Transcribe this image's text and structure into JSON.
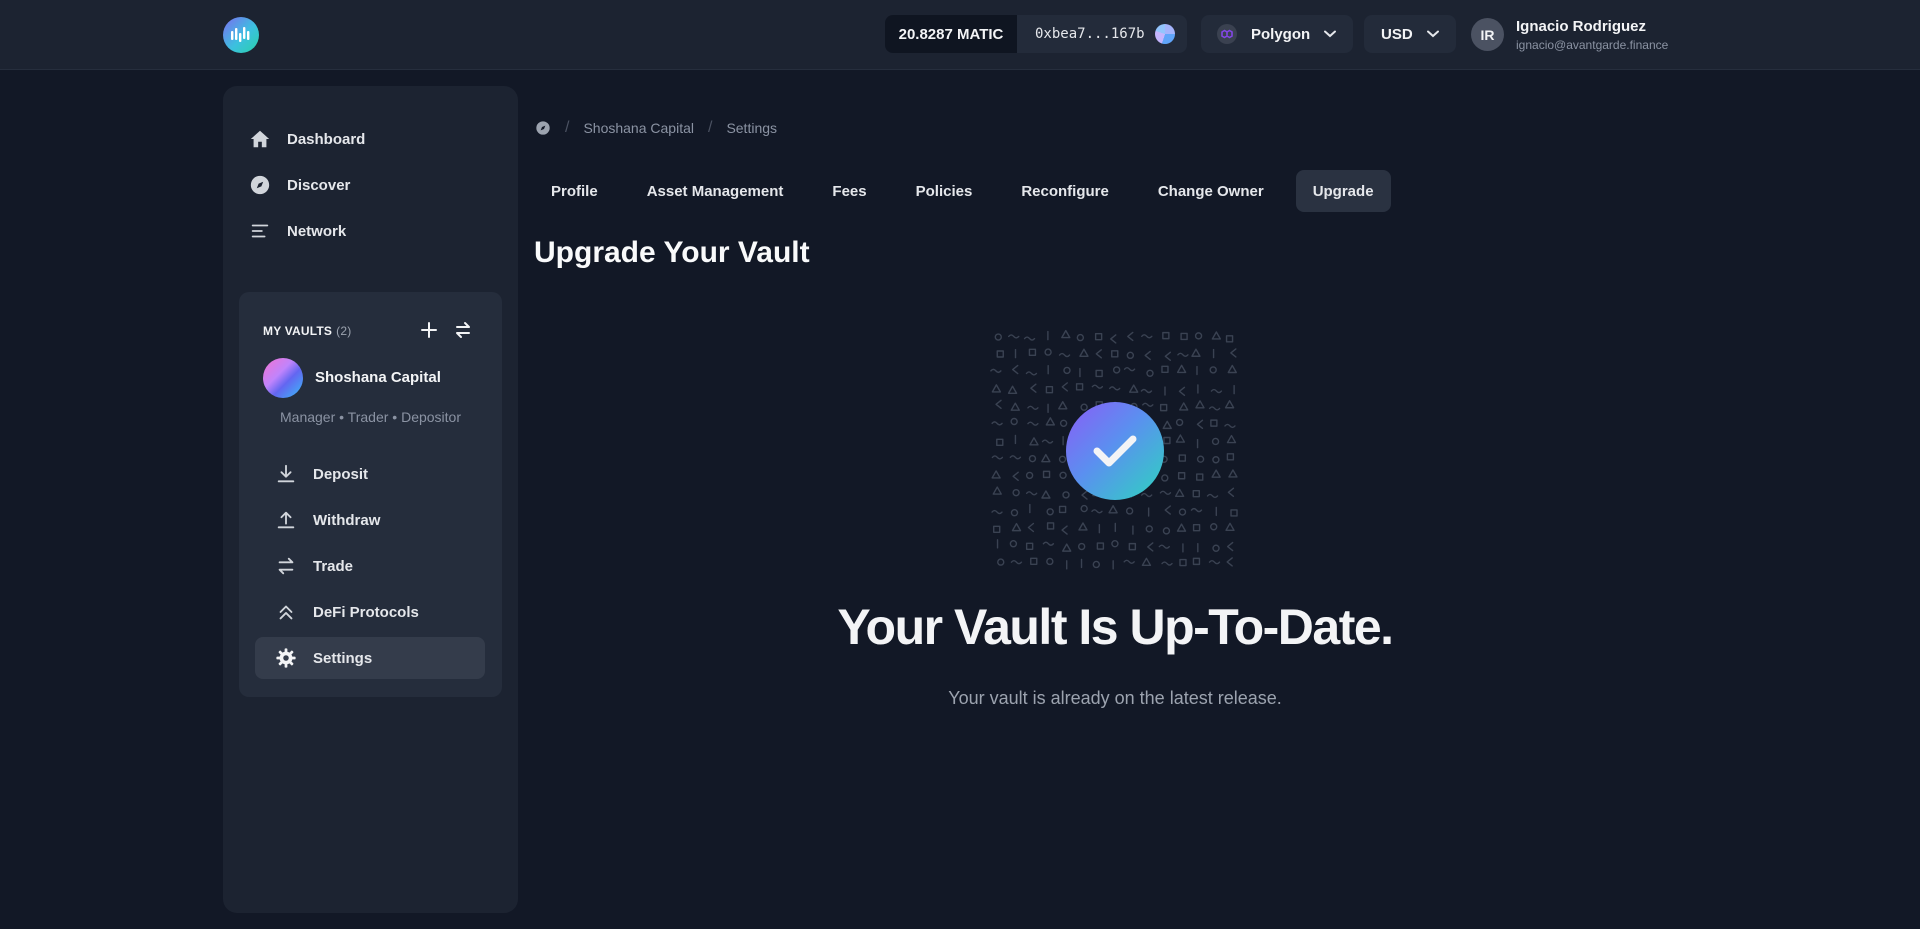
{
  "header": {
    "balance": "20.8287 MATIC",
    "address": "0xbea7...167b",
    "network": "Polygon",
    "currency": "USD",
    "user": {
      "initials": "IR",
      "name": "Ignacio Rodriguez",
      "email": "ignacio@avantgarde.finance"
    }
  },
  "sidebar": {
    "nav": [
      {
        "label": "Dashboard",
        "icon": "home-icon"
      },
      {
        "label": "Discover",
        "icon": "compass-icon"
      },
      {
        "label": "Network",
        "icon": "list-icon"
      }
    ],
    "vaults": {
      "title": "MY VAULTS",
      "count": "(2)",
      "vault_name": "Shoshana Capital",
      "roles": "Manager • Trader • Depositor",
      "items": [
        {
          "label": "Deposit",
          "icon": "download-icon"
        },
        {
          "label": "Withdraw",
          "icon": "upload-icon"
        },
        {
          "label": "Trade",
          "icon": "swap-icon"
        },
        {
          "label": "DeFi Protocols",
          "icon": "chevrons-up-icon"
        },
        {
          "label": "Settings",
          "icon": "gear-icon",
          "active": true
        }
      ]
    }
  },
  "breadcrumb": {
    "icon": "compass-icon",
    "items": [
      "Shoshana Capital",
      "Settings"
    ]
  },
  "tabs": [
    "Profile",
    "Asset Management",
    "Fees",
    "Policies",
    "Reconfigure",
    "Change Owner",
    "Upgrade"
  ],
  "active_tab": "Upgrade",
  "main": {
    "title": "Upgrade Your Vault",
    "status_heading": "Your Vault Is Up-To-Date.",
    "status_text": "Your vault is already on the latest release."
  },
  "colors": {
    "background": "#121826",
    "panel": "#1c2331",
    "accent_gradient_start": "#8b5cf6",
    "accent_gradient_end": "#2dd4bf"
  }
}
